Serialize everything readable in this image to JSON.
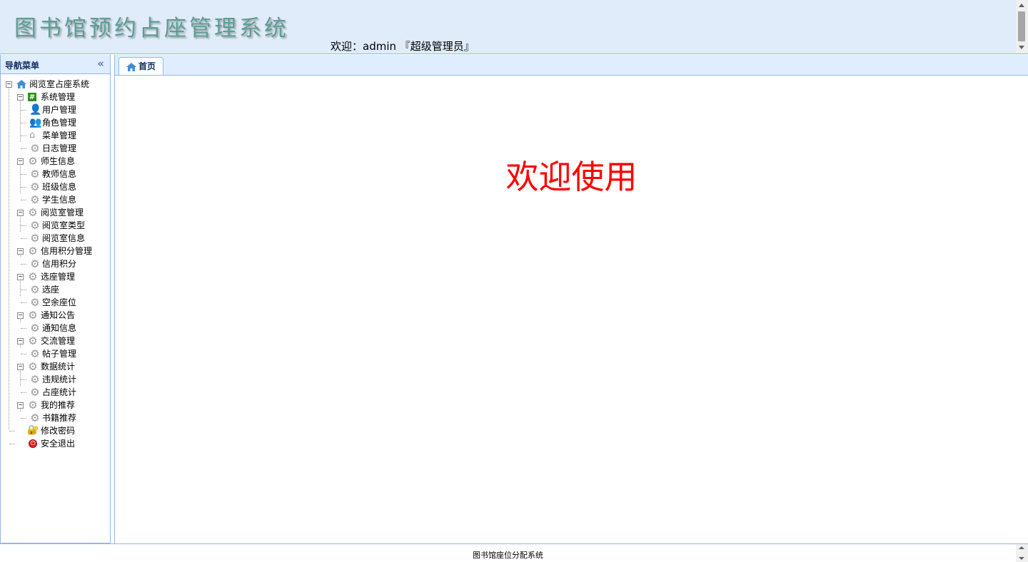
{
  "header": {
    "app_title": "图书馆预约占座管理系统",
    "welcome": "欢迎：admin 『超级管理员』"
  },
  "sidebar": {
    "title": "导航菜单",
    "root": "阅览室占座系统",
    "items": [
      "系统管理",
      "用户管理",
      "角色管理",
      "菜单管理",
      "日志管理",
      "师生信息",
      "教师信息",
      "班级信息",
      "学生信息",
      "阅览室管理",
      "阅览室类型",
      "阅览室信息",
      "信用积分管理",
      "信用积分",
      "选座管理",
      "选座",
      "空余座位",
      "通知公告",
      "通知信息",
      "交流管理",
      "帖子管理",
      "数据统计",
      "违规统计",
      "占座统计",
      "我的推荐",
      "书籍推荐",
      "修改密码",
      "安全退出"
    ]
  },
  "tabs": {
    "home": "首页"
  },
  "content": {
    "welcome": "欢迎使用"
  },
  "footer": {
    "text": "图书馆座位分配系统"
  },
  "icons": {
    "collapse": "double-chevron-left-icon",
    "home": "home-icon",
    "gear": "gear-icon"
  },
  "colors": {
    "header_bg": "#e0ecfa",
    "panel_border": "#95b8e7",
    "welcome_red": "#ff0000",
    "title_teal": "#5f9b97"
  }
}
